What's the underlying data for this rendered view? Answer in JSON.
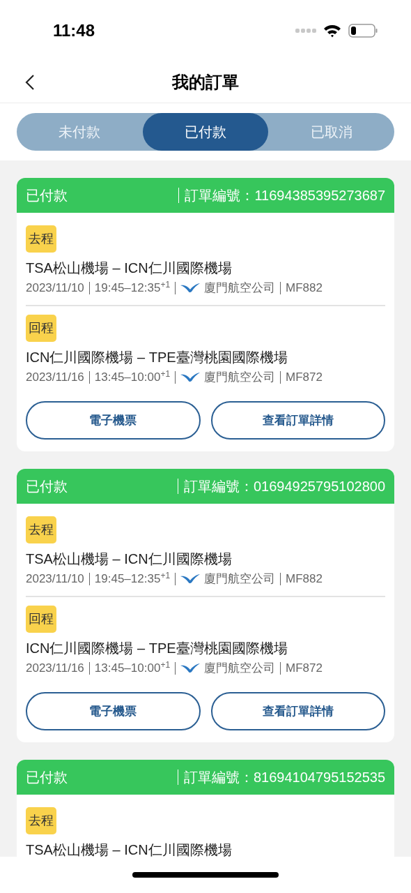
{
  "status_bar": {
    "time": "11:48"
  },
  "nav": {
    "title": "我的訂單"
  },
  "tabs": [
    {
      "label": "未付款",
      "selected": false
    },
    {
      "label": "已付款",
      "selected": true
    },
    {
      "label": "已取消",
      "selected": false
    }
  ],
  "orders": [
    {
      "status": "已付款",
      "order_no": "訂單編號：11694385395273687",
      "segments": [
        {
          "tag": "去程",
          "route": "TSA松山機場 – ICN仁川國際機場",
          "date": "2023/11/10",
          "time": "19:45–12:35$^{+1}$",
          "airline": "廈門航空公司",
          "flight": "MF882"
        },
        {
          "tag": "回程",
          "route": "ICN仁川國際機場 – TPE臺灣桃園國際機場",
          "date": "2023/11/16",
          "time": "13:45–10:00$^{+1}$",
          "airline": "廈門航空公司",
          "flight": "MF872"
        }
      ],
      "buttons": [
        "電子機票",
        "查看訂單詳情"
      ]
    },
    {
      "status": "已付款",
      "order_no": "訂單編號：01694925795102800",
      "segments": [
        {
          "tag": "去程",
          "route": "TSA松山機場 – ICN仁川國際機場",
          "date": "2023/11/10",
          "time": "19:45–12:35$^{+1}$",
          "airline": "廈門航空公司",
          "flight": "MF882"
        },
        {
          "tag": "回程",
          "route": "ICN仁川國際機場 – TPE臺灣桃園國際機場",
          "date": "2023/11/16",
          "time": "13:45–10:00$^{+1}$",
          "airline": "廈門航空公司",
          "flight": "MF872"
        }
      ],
      "buttons": [
        "電子機票",
        "查看訂單詳情"
      ]
    },
    {
      "status": "已付款",
      "order_no": "訂單編號：81694104795152535",
      "segments": [
        {
          "tag": "去程",
          "route": "TSA松山機場 – ICN仁川國際機場"
        }
      ]
    }
  ]
}
